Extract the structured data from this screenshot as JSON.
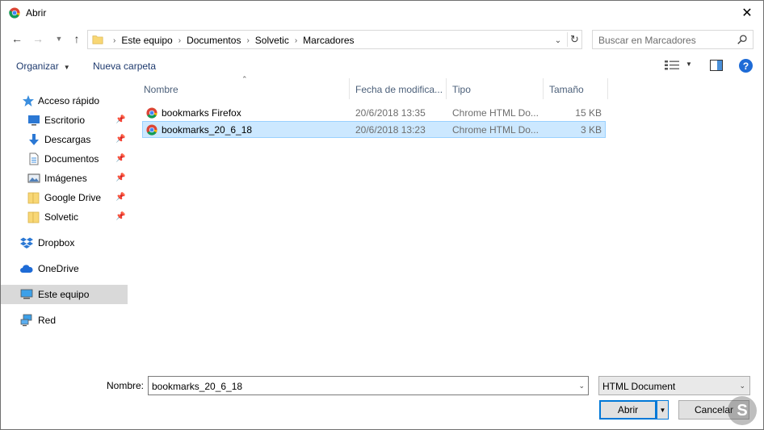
{
  "window": {
    "title": "Abrir"
  },
  "nav": {
    "breadcrumbs": [
      "Este equipo",
      "Documentos",
      "Solvetic",
      "Marcadores"
    ],
    "search_placeholder": "Buscar en Marcadores"
  },
  "toolbar": {
    "organize": "Organizar",
    "new_folder": "Nueva carpeta"
  },
  "sidebar": {
    "items": [
      {
        "label": "Acceso rápido",
        "icon": "star-icon",
        "pinned": false
      },
      {
        "label": "Escritorio",
        "icon": "desktop-icon",
        "pinned": true
      },
      {
        "label": "Descargas",
        "icon": "download-arrow-icon",
        "pinned": true
      },
      {
        "label": "Documentos",
        "icon": "document-icon",
        "pinned": true
      },
      {
        "label": "Imágenes",
        "icon": "pictures-icon",
        "pinned": true
      },
      {
        "label": "Google Drive",
        "icon": "folder-icon",
        "pinned": true
      },
      {
        "label": "Solvetic",
        "icon": "folder-icon",
        "pinned": true
      },
      {
        "label": "Dropbox",
        "icon": "dropbox-icon",
        "pinned": false
      },
      {
        "label": "OneDrive",
        "icon": "cloud-icon",
        "pinned": false
      },
      {
        "label": "Este equipo",
        "icon": "computer-icon",
        "pinned": false,
        "selected": true
      },
      {
        "label": "Red",
        "icon": "network-icon",
        "pinned": false
      }
    ]
  },
  "filelist": {
    "columns": [
      "Nombre",
      "Fecha de modifica...",
      "Tipo",
      "Tamaño"
    ],
    "rows": [
      {
        "name": "bookmarks Firefox",
        "date": "20/6/2018 13:35",
        "type": "Chrome HTML Do...",
        "size": "15 KB",
        "selected": false
      },
      {
        "name": "bookmarks_20_6_18",
        "date": "20/6/2018 13:23",
        "type": "Chrome HTML Do...",
        "size": "3 KB",
        "selected": true
      }
    ]
  },
  "footer": {
    "name_label": "Nombre:",
    "name_value": "bookmarks_20_6_18",
    "file_type": "HTML Document",
    "open_label": "Abrir",
    "cancel_label": "Cancelar"
  },
  "colors": {
    "selection_bg": "#cce8ff",
    "selection_border": "#99d1ff",
    "accent": "#0078d7"
  }
}
